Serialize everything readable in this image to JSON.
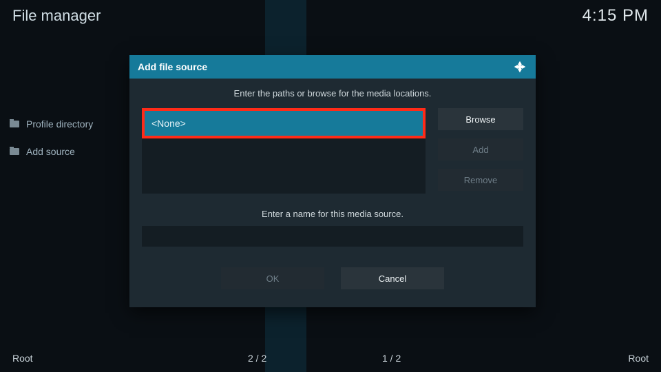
{
  "header": {
    "title": "File manager",
    "clock": "4:15 PM"
  },
  "sidebar": {
    "items": [
      {
        "label": "Profile directory"
      },
      {
        "label": "Add source"
      }
    ]
  },
  "footer": {
    "left": "Root",
    "mid_a": "2 / 2",
    "mid_b": "1 / 2",
    "right": "Root"
  },
  "dialog": {
    "title": "Add file source",
    "instruction": "Enter the paths or browse for the media locations.",
    "path_value": "<None>",
    "buttons": {
      "browse": "Browse",
      "add": "Add",
      "remove": "Remove"
    },
    "name_label": "Enter a name for this media source.",
    "name_value": "",
    "ok": "OK",
    "cancel": "Cancel"
  }
}
